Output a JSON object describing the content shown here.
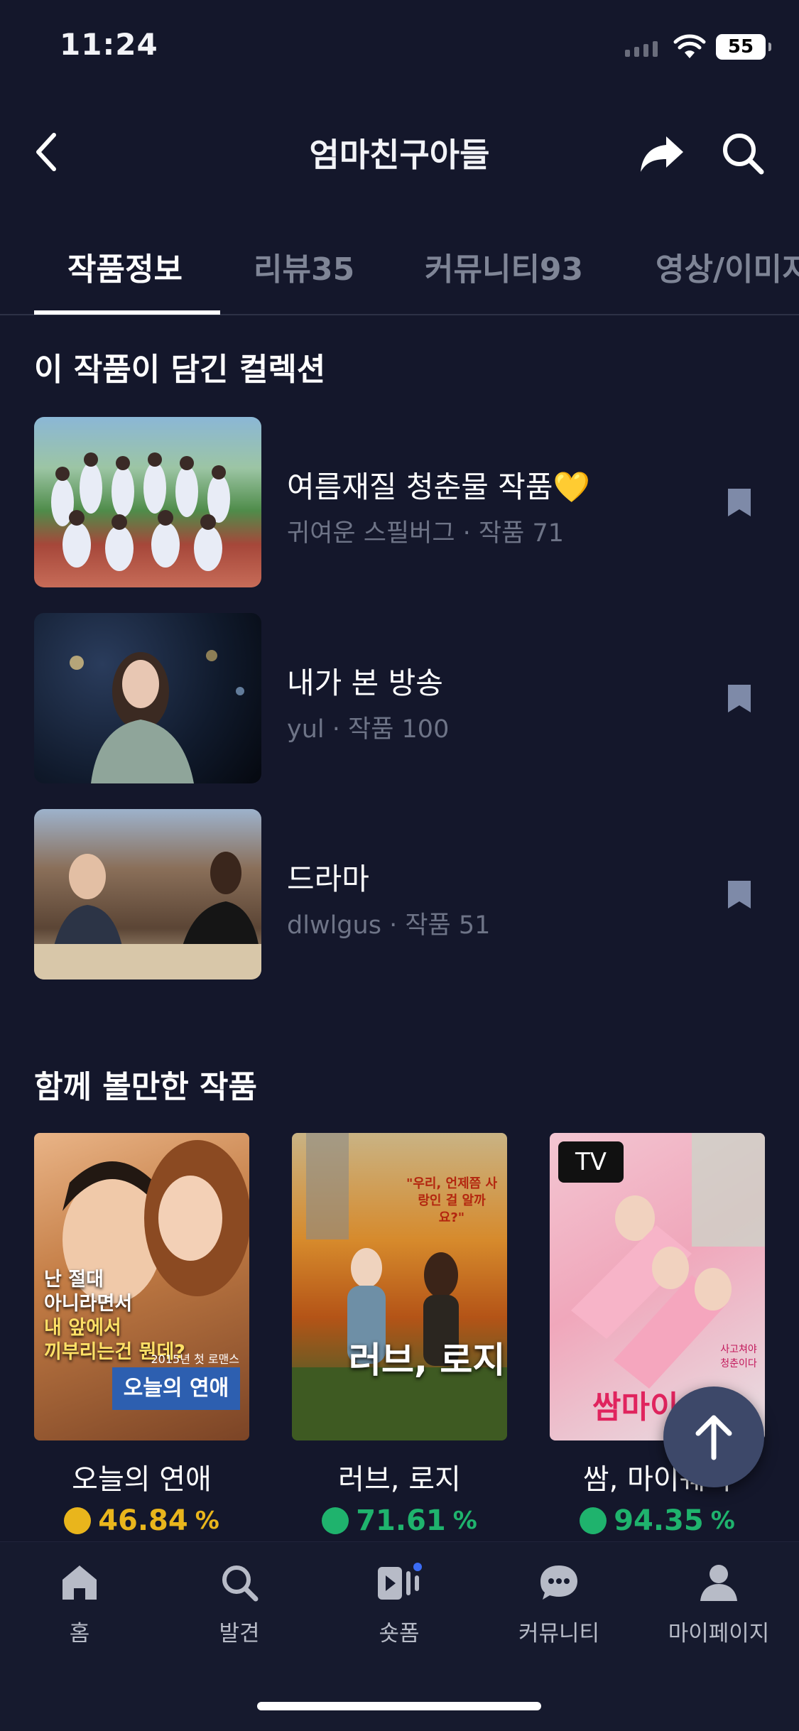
{
  "status": {
    "time": "11:24",
    "battery": "55"
  },
  "header": {
    "title": "엄마친구아들"
  },
  "tabs": [
    {
      "label": "작품정보"
    },
    {
      "label": "리뷰35"
    },
    {
      "label": "커뮤니티93"
    },
    {
      "label": "영상/이미지"
    }
  ],
  "collections": {
    "title": "이 작품이 담긴 컬렉션",
    "items": [
      {
        "title": "여름재질 청춘물 작품💛",
        "author": "귀여운 스필버그",
        "count": "작품 71"
      },
      {
        "title": "내가 본 방송",
        "author": "yul",
        "count": "작품 100"
      },
      {
        "title": "드라마",
        "author": "dlwlgus",
        "count": "작품 51"
      }
    ]
  },
  "recommend": {
    "title": "함께 볼만한 작품",
    "items": [
      {
        "title": "오늘의 연애",
        "rate": "46.84",
        "unit": "%",
        "color": "#e9b51c"
      },
      {
        "title": "러브, 로지",
        "rate": "71.61",
        "unit": "%",
        "color": "#1fb36d"
      },
      {
        "title": "쌈, 마이웨이",
        "rate": "94.35",
        "unit": "%",
        "color": "#1fb36d",
        "badge": "TV"
      }
    ],
    "poster_texts": {
      "p1_line1": "난 절대",
      "p1_line2": "아니라면서",
      "p1_line3": "내 앞에서",
      "p1_line4": "끼부리는건 뭔데?",
      "p1_year": "2015년 첫 로맨스",
      "p1_logo": "오늘의 연애",
      "p2_tag": "\"우리, 언제쯤 사랑인 걸 알까요?\"",
      "p2_logo": "러브, 로지",
      "p3_tag": "사고쳐야 청춘이다",
      "p3_logo": "쌈마이"
    }
  },
  "nav": [
    {
      "label": "홈",
      "icon": "home-icon"
    },
    {
      "label": "발견",
      "icon": "search-icon"
    },
    {
      "label": "숏폼",
      "icon": "shortform-icon"
    },
    {
      "label": "커뮤니티",
      "icon": "chat-icon"
    },
    {
      "label": "마이페이지",
      "icon": "person-icon"
    }
  ]
}
